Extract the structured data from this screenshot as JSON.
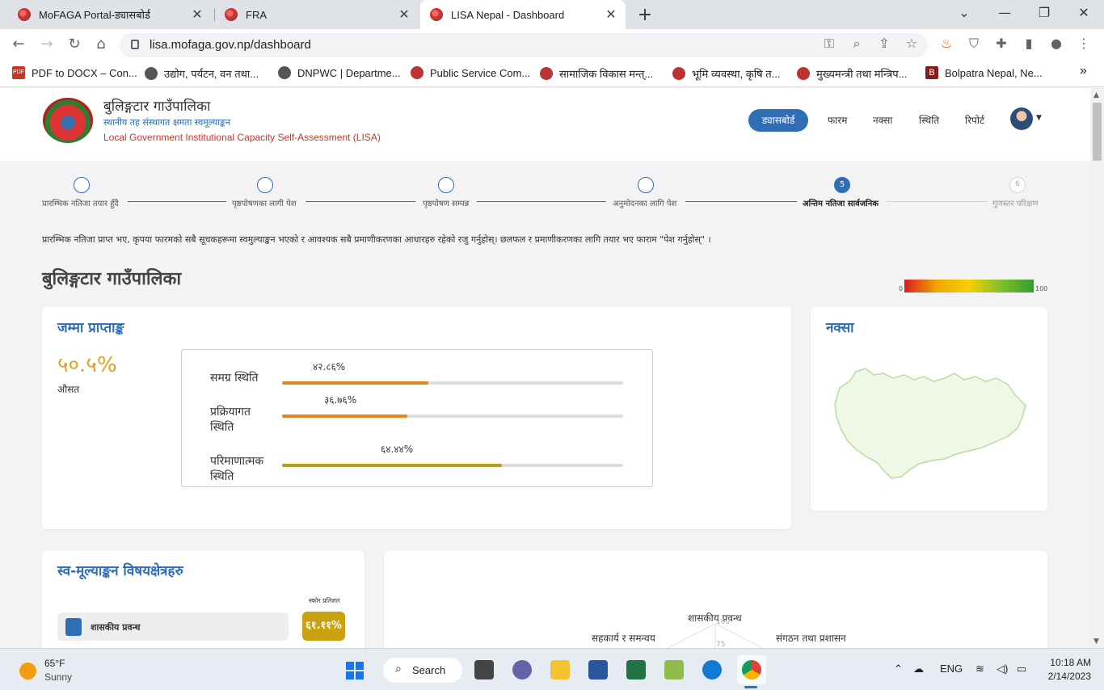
{
  "browser": {
    "tabs": [
      {
        "title": "MoFAGA Portal-ड्यासबोर्ड"
      },
      {
        "title": "FRA"
      },
      {
        "title": "LISA Nepal - Dashboard"
      }
    ],
    "new_tab": "+",
    "url": "lisa.mofaga.gov.np/dashboard",
    "bookmarks": [
      "PDF to DOCX – Con...",
      "उद्योग, पर्यटन, वन तथा...",
      "DNPWC | Departme...",
      "Public Service Com...",
      "सामाजिक विकास मन्त्...",
      "भूमि व्यवस्था, कृषि त...",
      "मुख्यमन्त्री तथा मन्त्रिप...",
      "Bolpatra Nepal, Ne..."
    ],
    "more": "»"
  },
  "header": {
    "org_name": "बुलिङ्गटार गाउँपालिका",
    "org_sub": "स्थानीय तह संस्थागत क्षमता स्वमूल्याङ्कन",
    "org_eng": "Local Government Institutional Capacity Self-Assessment (LISA)",
    "nav": [
      "ड्यासबोर्ड",
      "फारम",
      "नक्सा",
      "स्थिति",
      "रिपोर्ट"
    ]
  },
  "stepper": {
    "steps": [
      {
        "label": "प्रारम्भिक नतिजा तयार हुँदै",
        "state": "done"
      },
      {
        "label": "पृष्ठपोषणका लागी पेश",
        "state": "done"
      },
      {
        "label": "पृष्ठपोषण सम्पन्न",
        "state": "done"
      },
      {
        "label": "अनुमोदनका लागि पेश",
        "state": "done"
      },
      {
        "label": "अन्तिम नतिजा सार्वजनिक",
        "state": "active",
        "num": "5"
      },
      {
        "label": "गुणस्तर परिक्षण",
        "state": "pending",
        "num": "6"
      }
    ]
  },
  "notice": "प्रारम्भिक नतिजा प्राप्त भए, कृपया फारमको सबै सूचकहरूमा स्वमुल्याङ्कन भएको र आवश्यक सबै प्रमाणीकरणका आधारहरु रहेको रजु गर्नुहोस्। छलफल र प्रमाणीकरणका लागि तयार भए फाराम \"पेश गर्नुहोस्\" ।",
  "page_title": "बुलिङ्गटार गाउँपालिका",
  "scale": {
    "min": "0",
    "max": "100"
  },
  "score_card": {
    "title": "जम्मा प्राप्ताङ्क",
    "total": "५०.५%",
    "total_label": "औसत",
    "bars": [
      {
        "label": "समग्र स्थिति",
        "value_text": "४२.८६%",
        "value": 42.86,
        "color": "#e5861a"
      },
      {
        "label": "प्रक्रियागत स्थिति",
        "value_text": "३६.७६%",
        "value": 36.76,
        "color": "#e5861a"
      },
      {
        "label": "परिमाणात्मक स्थिति",
        "value_text": "६४.४४%",
        "value": 64.44,
        "color": "#b9a010"
      }
    ]
  },
  "map_card": {
    "title": "नक्सा"
  },
  "thematic_card": {
    "title": "स्व-मूल्याङ्कन विषयक्षेत्रहरु",
    "col_head": "स्कोर प्रतिशत",
    "items": [
      {
        "label": "शासकीय प्रवन्ध",
        "pct": "६१.११%"
      }
    ]
  },
  "radar_card": {
    "labels": [
      "शासकीय प्रवन्ध",
      "सहकार्य र समन्वय",
      "संगठन तथा प्रशासन"
    ],
    "ticks": [
      "100",
      "75"
    ]
  },
  "taskbar": {
    "temp": "65°F",
    "condition": "Sunny",
    "search": "Search",
    "lang": "ENG",
    "time": "10:18 AM",
    "date": "2/14/2023"
  }
}
